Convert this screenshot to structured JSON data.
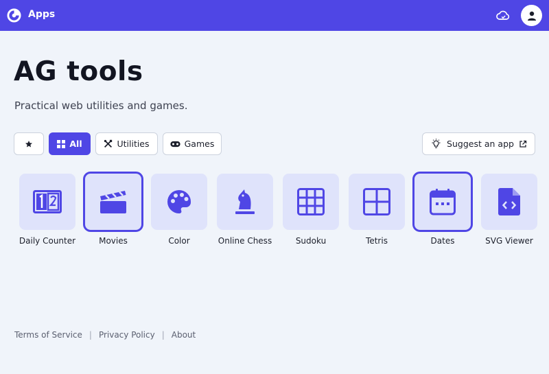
{
  "header": {
    "title": "Apps",
    "logo_icon": "pie-logo-icon",
    "cloud_icon": "cloud-sync-icon",
    "avatar_icon": "user-icon"
  },
  "main": {
    "title": "AG tools",
    "subtitle": "Practical web utilities and games."
  },
  "filters": [
    {
      "label": "",
      "icon": "star-icon",
      "active": false
    },
    {
      "label": "All",
      "icon": "grid-icon",
      "active": true
    },
    {
      "label": "Utilities",
      "icon": "tools-icon",
      "active": false
    },
    {
      "label": "Games",
      "icon": "gamepad-icon",
      "active": false
    }
  ],
  "suggest": {
    "label": "Suggest an app",
    "icon": "lightbulb-icon",
    "external_icon": "external-link-icon"
  },
  "apps": [
    {
      "label": "Daily Counter",
      "icon": "counter-icon",
      "selected": false
    },
    {
      "label": "Movies",
      "icon": "clapperboard-icon",
      "selected": true
    },
    {
      "label": "Color",
      "icon": "palette-icon",
      "selected": false
    },
    {
      "label": "Online Chess",
      "icon": "chess-knight-icon",
      "selected": false
    },
    {
      "label": "Sudoku",
      "icon": "sudoku-grid-icon",
      "selected": false
    },
    {
      "label": "Tetris",
      "icon": "tetris-grid-icon",
      "selected": false
    },
    {
      "label": "Dates",
      "icon": "calendar-icon",
      "selected": true
    },
    {
      "label": "SVG Viewer",
      "icon": "svg-file-icon",
      "selected": false
    }
  ],
  "footer": {
    "terms": "Terms of Service",
    "privacy": "Privacy Policy",
    "about": "About",
    "separator": "|"
  },
  "colors": {
    "accent": "#4f46e5",
    "tile_bg": "#dfe3fb",
    "page_bg": "#f0f4fa"
  }
}
